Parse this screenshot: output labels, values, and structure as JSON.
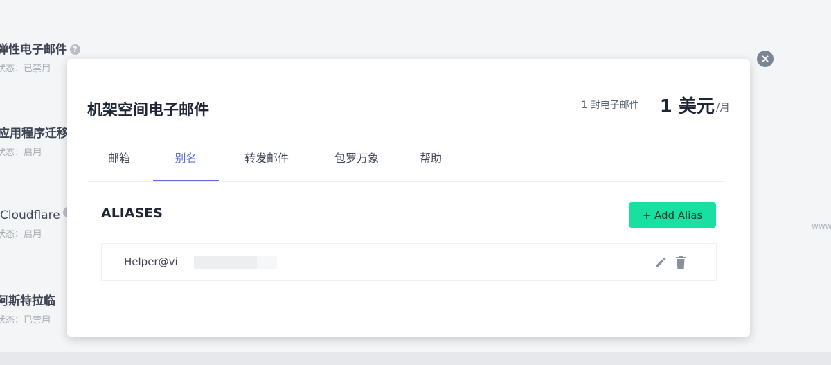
{
  "background": {
    "addons": [
      {
        "name": "弹性电子邮件",
        "status": "状态：已禁用",
        "has_help_icon": true,
        "help_icon_glyph": "?"
      },
      {
        "name": "应用程序迁移",
        "status": "状态：启用",
        "has_help_icon": false
      },
      {
        "name": "Cloudflare",
        "status": "状态：启用",
        "has_help_icon": true,
        "help_icon_glyph": ""
      },
      {
        "name": "阿斯特拉临",
        "status": "状态：已禁用",
        "has_help_icon": false
      }
    ],
    "right_fragment": "www"
  },
  "modal": {
    "title": "机架空间电子邮件",
    "email_count": "1 封电子邮件",
    "price_value": "1 美元",
    "price_unit": "/月",
    "close_icon": "close-icon",
    "tabs": [
      {
        "label": "邮箱",
        "active": false
      },
      {
        "label": "别名",
        "active": true
      },
      {
        "label": "转发邮件",
        "active": false
      },
      {
        "label": "包罗万象",
        "active": false
      },
      {
        "label": "帮助",
        "active": false
      }
    ],
    "aliases": {
      "heading": "ALIASES",
      "add_button_label": "+ Add Alias",
      "rows": [
        {
          "alias": "Helper@vi",
          "edit_icon": "pencil-icon",
          "delete_icon": "trash-icon"
        }
      ]
    }
  },
  "colors": {
    "accent_tab": "#5b6dd9",
    "add_button": "#19e0a0",
    "close_button": "#7c8594"
  }
}
